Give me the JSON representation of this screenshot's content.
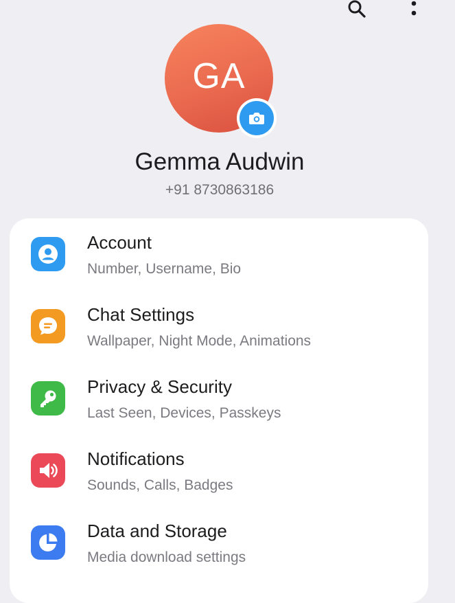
{
  "header": {
    "search_icon": "search-icon",
    "more_icon": "more-vertical-icon"
  },
  "profile": {
    "initials": "GA",
    "name": "Gemma Audwin",
    "phone": "+91 8730863186",
    "avatar_color": "#ec6e50",
    "camera_icon": "camera-icon",
    "camera_badge_color": "#2e9bf0"
  },
  "settings": {
    "items": [
      {
        "title": "Account",
        "subtitle": "Number, Username, Bio",
        "icon": "person-icon",
        "color": "#2f9bf0"
      },
      {
        "title": "Chat Settings",
        "subtitle": "Wallpaper, Night Mode, Animations",
        "icon": "chat-bubble-icon",
        "color": "#f29a22"
      },
      {
        "title": "Privacy & Security",
        "subtitle": "Last Seen, Devices, Passkeys",
        "icon": "key-icon",
        "color": "#3fba48"
      },
      {
        "title": "Notifications",
        "subtitle": "Sounds, Calls, Badges",
        "icon": "speaker-icon",
        "color": "#ec4958"
      },
      {
        "title": "Data and Storage",
        "subtitle": "Media download settings",
        "icon": "pie-chart-icon",
        "color": "#3d7bf0"
      }
    ]
  }
}
